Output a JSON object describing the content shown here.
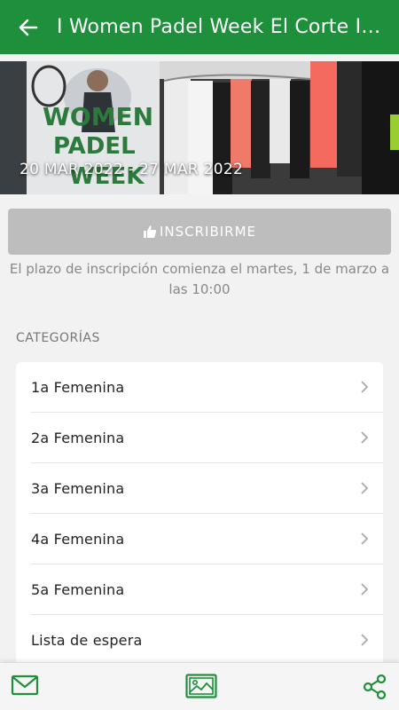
{
  "header": {
    "title": "I Women Padel Week El Corte Inglés",
    "back_icon": "arrow-left-icon",
    "background": "#1e8f3b"
  },
  "banner": {
    "date_range": "20 MAR 2022 - 27 MAR 2022",
    "poster_text": "WOMEN PADEL WEEK"
  },
  "register": {
    "label": "INSCRIBIRME",
    "icon": "thumbs-up-icon",
    "notice": "El plazo de inscripción comienza el martes, 1 de marzo a las 10:00"
  },
  "categories": {
    "section_label": "CATEGORÍAS",
    "items": [
      {
        "label": "1a Femenina"
      },
      {
        "label": "2a Femenina"
      },
      {
        "label": "3a Femenina"
      },
      {
        "label": "4a Femenina"
      },
      {
        "label": "5a Femenina"
      },
      {
        "label": "Lista de espera"
      }
    ]
  },
  "bottom_bar": {
    "icons": [
      "mail-icon",
      "gallery-icon",
      "share-icon"
    ],
    "accent": "#1e8f3b"
  }
}
